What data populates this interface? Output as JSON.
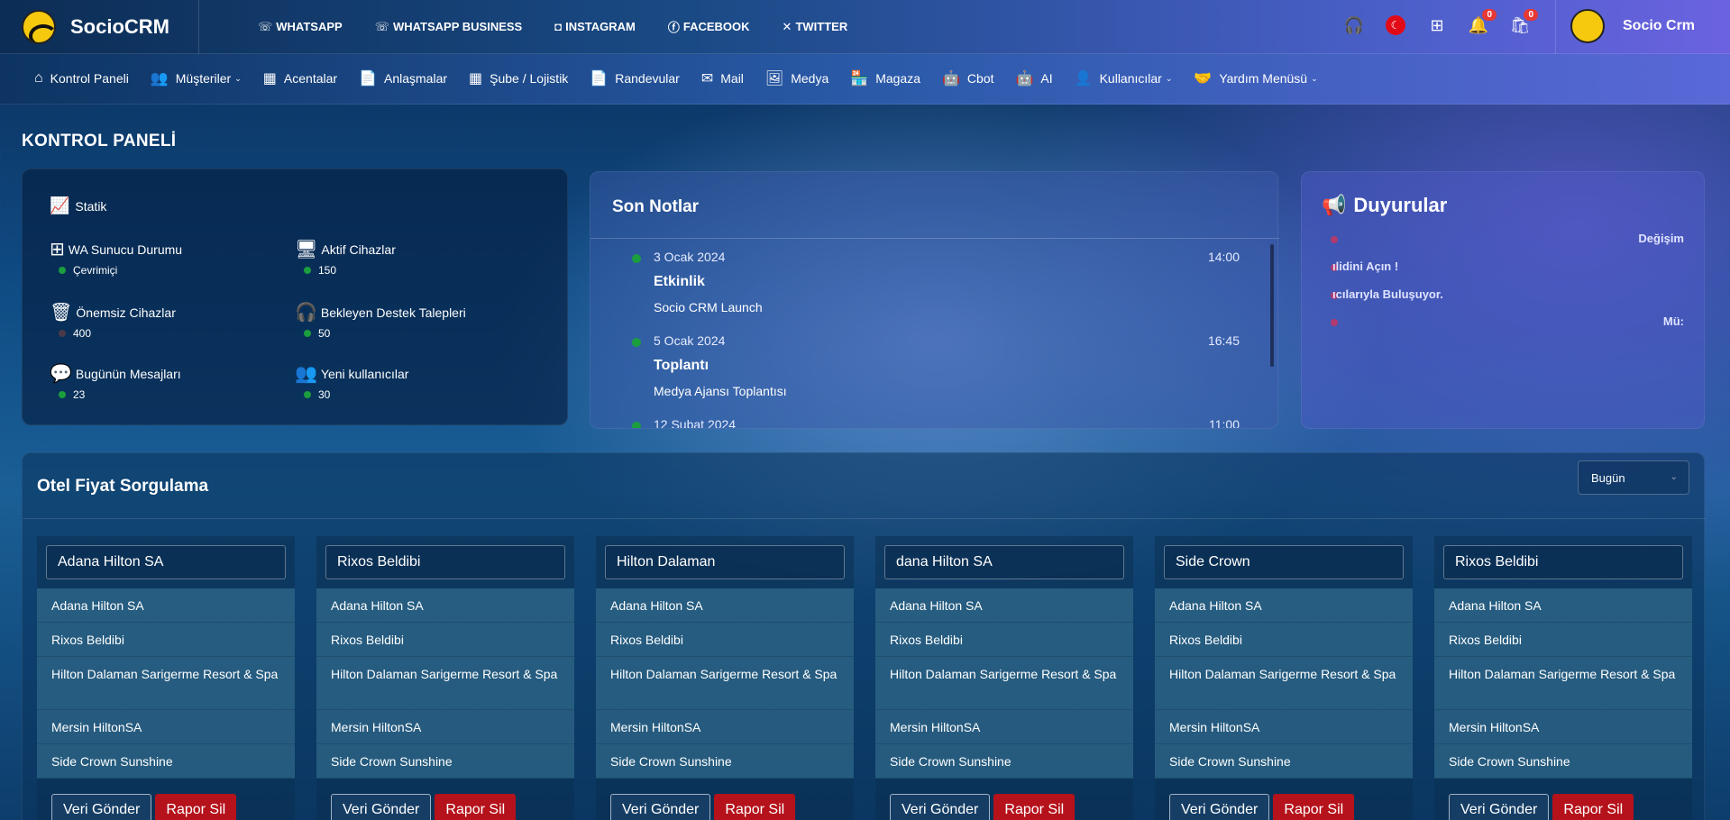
{
  "brand": {
    "name": "SocioCRM"
  },
  "social": [
    {
      "label": "WHATSAPP",
      "icon": "whatsapp-icon",
      "glyph": "☏"
    },
    {
      "label": "WHATSAPP BUSINESS",
      "icon": "whatsapp-business-icon",
      "glyph": "☏"
    },
    {
      "label": "INSTAGRAM",
      "icon": "instagram-icon",
      "glyph": "◘"
    },
    {
      "label": "FACEBOOK",
      "icon": "facebook-icon",
      "glyph": "ⓕ"
    },
    {
      "label": "TWITTER",
      "icon": "x-twitter-icon",
      "glyph": "✕"
    }
  ],
  "top_icons": {
    "notifications_count": "0",
    "cart_count": "0"
  },
  "user": {
    "name": "Socio Crm"
  },
  "nav": [
    {
      "label": "Kontrol Paneli",
      "icon": "home-icon",
      "glyph": "⌂",
      "caret": ""
    },
    {
      "label": "Müşteriler",
      "icon": "users-icon",
      "glyph": "👥",
      "caret": "⌄"
    },
    {
      "label": "Acentalar",
      "icon": "building-icon",
      "glyph": "▦",
      "caret": ""
    },
    {
      "label": "Anlaşmalar",
      "icon": "file-contract-icon",
      "glyph": "📄",
      "caret": ""
    },
    {
      "label": "Şube / Lojistik",
      "icon": "branch-building-icon",
      "glyph": "▦",
      "caret": ""
    },
    {
      "label": "Randevular",
      "icon": "document-icon",
      "glyph": "📄",
      "caret": ""
    },
    {
      "label": "Mail",
      "icon": "mail-icon",
      "glyph": "✉",
      "caret": ""
    },
    {
      "label": "Medya",
      "icon": "images-icon",
      "glyph": "🖼",
      "caret": ""
    },
    {
      "label": "Magaza",
      "icon": "store-icon",
      "glyph": "🏪",
      "caret": ""
    },
    {
      "label": "Cbot",
      "icon": "robot-icon",
      "glyph": "🤖",
      "caret": ""
    },
    {
      "label": "AI",
      "icon": "ai-robot-icon",
      "glyph": "🤖",
      "caret": ""
    },
    {
      "label": "Kullanıcılar",
      "icon": "user-icon",
      "glyph": "👤",
      "caret": "⌄"
    },
    {
      "label": "Yardım Menüsü",
      "icon": "handshake-icon",
      "glyph": "🤝",
      "caret": "⌄"
    }
  ],
  "page_title": "KONTROL PANELİ",
  "stats": {
    "header": "Statik",
    "items": [
      {
        "label": "WA Sunucu Durumu",
        "value": "Çevrimiçi",
        "icon": "network-icon",
        "glyph": "⊞",
        "dim": false
      },
      {
        "label": "Aktif Cihazlar",
        "value": "150",
        "icon": "desktop-icon",
        "glyph": "🖥",
        "dim": false
      },
      {
        "label": "Önemsiz Cihazlar",
        "value": "400",
        "icon": "trash-icon",
        "glyph": "🗑",
        "dim": true
      },
      {
        "label": "Bekleyen Destek Talepleri",
        "value": "50",
        "icon": "headset-icon",
        "glyph": "🎧",
        "dim": false
      },
      {
        "label": "Bugünün Mesajları",
        "value": "23",
        "icon": "chat-icon",
        "glyph": "💬",
        "dim": false
      },
      {
        "label": "Yeni kullanıcılar",
        "value": "30",
        "icon": "users-group-icon",
        "glyph": "👥",
        "dim": false
      }
    ]
  },
  "notes": {
    "title": "Son Notlar",
    "items": [
      {
        "date": "3 Ocak 2024",
        "time": "14:00",
        "title": "Etkinlik",
        "desc": "Socio CRM Launch"
      },
      {
        "date": "5 Ocak 2024",
        "time": "16:45",
        "title": "Toplantı",
        "desc": "Medya Ajansı Toplantısı"
      },
      {
        "date": "12 Şubat 2024",
        "time": "11:00",
        "title": "",
        "desc": ""
      }
    ]
  },
  "announcements": {
    "title": "Duyurular",
    "items": [
      {
        "text": "Değişim"
      },
      {
        "text": "ılidini Açın !"
      },
      {
        "text": "ıcılarıyla Buluşuyor."
      },
      {
        "text": "Mü:"
      }
    ]
  },
  "hotel": {
    "title": "Otel Fiyat Sorgulama",
    "period": "Bugün",
    "options": [
      "Adana Hilton SA",
      "Rixos Beldibi",
      "Hilton Dalaman Sarigerme Resort & Spa",
      "Mersin HiltonSA",
      "Side Crown Sunshine"
    ],
    "send_label": "Veri Gönder",
    "delete_label": "Rapor Sil",
    "columns": [
      {
        "value": "Adana Hilton SA"
      },
      {
        "value": "Rixos Beldibi"
      },
      {
        "value": "Hilton Dalaman"
      },
      {
        "value": "dana Hilton SA"
      },
      {
        "value": "Side Crown"
      },
      {
        "value": "Rixos Beldibi"
      }
    ]
  }
}
